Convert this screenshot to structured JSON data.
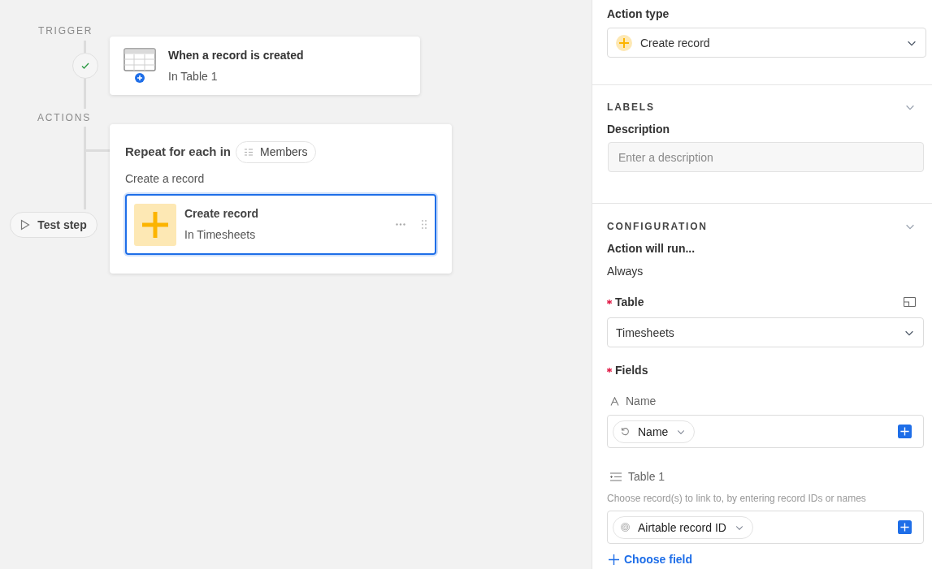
{
  "canvas": {
    "trigger_label": "TRIGGER",
    "trigger": {
      "done": true,
      "title": "When a record is created",
      "subtitle": "In Table 1"
    },
    "actions_label": "ACTIONS",
    "test_button": "Test step",
    "group": {
      "repeat_label": "Repeat for each in",
      "repeat_source": "Members",
      "subheading": "Create a record",
      "step": {
        "title": "Create record",
        "subtitle": "In Timesheets",
        "selected": true
      }
    }
  },
  "panel": {
    "action_type": {
      "label": "Action type",
      "value": "Create record"
    },
    "labels": {
      "title": "LABELS",
      "description_label": "Description",
      "placeholder": "Enter a description"
    },
    "configuration": {
      "title": "CONFIGURATION",
      "run_label": "Action will run...",
      "run_value": "Always",
      "table": {
        "label": "Table",
        "required": true,
        "value": "Timesheets"
      },
      "fields": {
        "label": "Fields",
        "required": true,
        "items": [
          {
            "kind": "text",
            "name": "Name",
            "token": "Name"
          },
          {
            "kind": "link",
            "name": "Table 1",
            "hint": "Choose record(s) to link to, by entering record IDs or names",
            "token": "Airtable record ID"
          }
        ]
      },
      "choose_field": "Choose field"
    }
  }
}
